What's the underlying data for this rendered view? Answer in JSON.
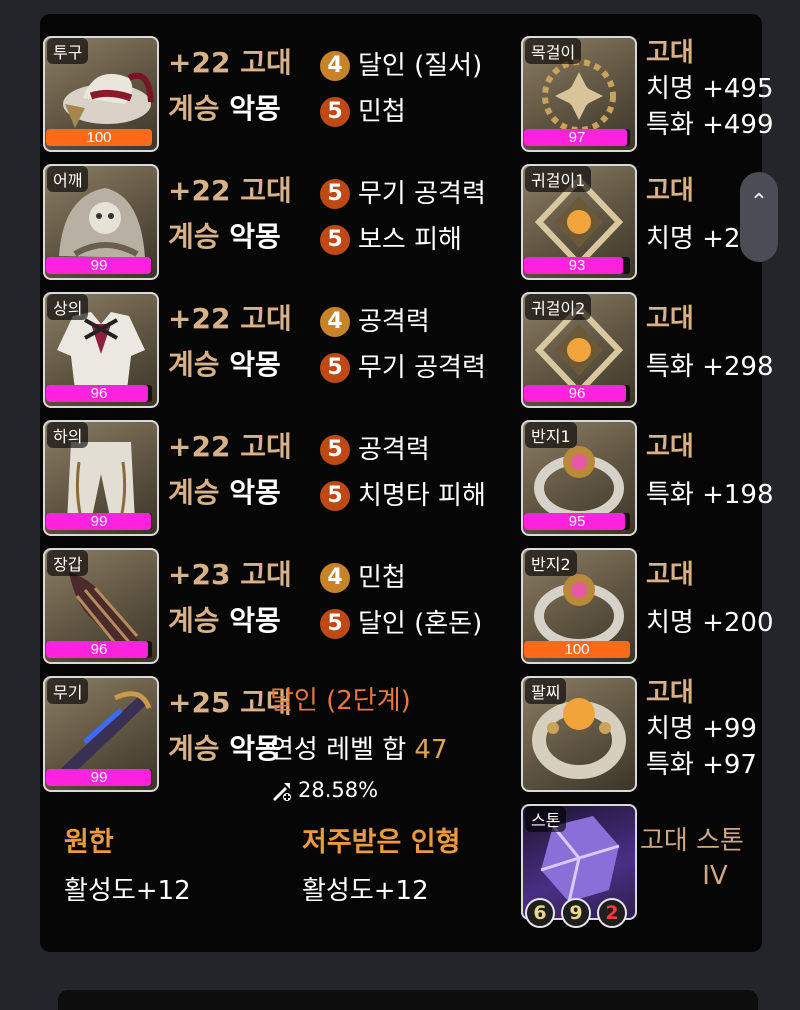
{
  "equipment": [
    {
      "slot": "투구",
      "quality": "100",
      "quality_pct": 100,
      "bar_color": "#ff6a1a",
      "refine": "+22",
      "grade": "고대",
      "transcend_label": "계승",
      "transcend_value": "악몽",
      "engravings": [
        {
          "level": "4",
          "name": "달인 (질서)"
        },
        {
          "level": "5",
          "name": "민첩"
        }
      ]
    },
    {
      "slot": "어깨",
      "quality": "99",
      "quality_pct": 99,
      "bar_color": "#ff22dd",
      "refine": "+22",
      "grade": "고대",
      "transcend_label": "계승",
      "transcend_value": "악몽",
      "engravings": [
        {
          "level": "5",
          "name": "무기 공격력"
        },
        {
          "level": "5",
          "name": "보스 피해"
        }
      ]
    },
    {
      "slot": "상의",
      "quality": "96",
      "quality_pct": 96,
      "bar_color": "#ff22dd",
      "refine": "+22",
      "grade": "고대",
      "transcend_label": "계승",
      "transcend_value": "악몽",
      "engravings": [
        {
          "level": "4",
          "name": "공격력"
        },
        {
          "level": "5",
          "name": "무기 공격력"
        }
      ]
    },
    {
      "slot": "하의",
      "quality": "99",
      "quality_pct": 99,
      "bar_color": "#ff22dd",
      "refine": "+22",
      "grade": "고대",
      "transcend_label": "계승",
      "transcend_value": "악몽",
      "engravings": [
        {
          "level": "5",
          "name": "공격력"
        },
        {
          "level": "5",
          "name": "치명타 피해"
        }
      ]
    },
    {
      "slot": "장갑",
      "quality": "96",
      "quality_pct": 96,
      "bar_color": "#ff22dd",
      "refine": "+23",
      "grade": "고대",
      "transcend_label": "계승",
      "transcend_value": "악몽",
      "engravings": [
        {
          "level": "4",
          "name": "민첩"
        },
        {
          "level": "5",
          "name": "달인 (혼돈)"
        }
      ]
    },
    {
      "slot": "무기",
      "quality": "99",
      "quality_pct": 99,
      "bar_color": "#ff22dd",
      "refine": "+25",
      "grade": "고대",
      "transcend_label": "계승",
      "transcend_value": "악몽"
    }
  ],
  "weapon_extra": {
    "elixir_tier": "달인 (2단계)",
    "refine_sum_label": "연성 레벨 합",
    "refine_sum_value": "47",
    "transcend_percent": "28.58%",
    "transcend_icon": "sword-upgrade-icon"
  },
  "accessories": [
    {
      "slot": "목걸이",
      "quality": "97",
      "quality_pct": 97,
      "bar_color": "#ff22dd",
      "grade": "고대",
      "stats": [
        "치명 +495",
        "특화 +499"
      ]
    },
    {
      "slot": "귀걸이1",
      "quality": "93",
      "quality_pct": 93,
      "bar_color": "#ff22dd",
      "grade": "고대",
      "stats": [
        "치명 +296"
      ]
    },
    {
      "slot": "귀걸이2",
      "quality": "96",
      "quality_pct": 96,
      "bar_color": "#ff22dd",
      "grade": "고대",
      "stats": [
        "특화 +298"
      ]
    },
    {
      "slot": "반지1",
      "quality": "95",
      "quality_pct": 95,
      "bar_color": "#ff22dd",
      "grade": "고대",
      "stats": [
        "특화 +198"
      ]
    },
    {
      "slot": "반지2",
      "quality": "100",
      "quality_pct": 100,
      "bar_color": "#ff6a1a",
      "grade": "고대",
      "stats": [
        "치명 +200"
      ]
    },
    {
      "slot": "팔찌",
      "grade": "고대",
      "stats": [
        "치명 +99",
        "특화 +97"
      ]
    }
  ],
  "stone": {
    "slot": "스톤",
    "title": "고대 스톤",
    "tier": "IV",
    "engravings": [
      "6",
      "9",
      "2"
    ],
    "engraving_colors": [
      "#e6d98a",
      "#e6d98a",
      "#ff3a3a"
    ]
  },
  "abilities": [
    {
      "title": "원한",
      "effect": "활성도+12"
    },
    {
      "title": "저주받은 인형",
      "effect": "활성도+12"
    }
  ],
  "scroll_icon": "chevron-up-icon"
}
